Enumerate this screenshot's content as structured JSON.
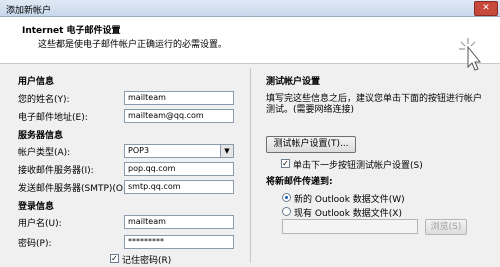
{
  "window": {
    "title": "添加新帐户",
    "close_glyph": "✕"
  },
  "header": {
    "title": "Internet 电子邮件设置",
    "description": "这些都是使电子邮件帐户正确运行的必需设置。",
    "icon": "wizard-cursor-icon"
  },
  "user_info": {
    "heading": "用户信息",
    "name_label": "您的姓名(Y):",
    "name_value": "mailteam",
    "email_label": "电子邮件地址(E):",
    "email_value": "mailteam@qq.com"
  },
  "server_info": {
    "heading": "服务器信息",
    "account_type_label": "帐户类型(A):",
    "account_type_value": "POP3",
    "incoming_label": "接收邮件服务器(I):",
    "incoming_value": "pop.qq.com",
    "outgoing_label": "发送邮件服务器(SMTP)(O):",
    "outgoing_value": "smtp.qq.com"
  },
  "login_info": {
    "heading": "登录信息",
    "username_label": "用户名(U):",
    "username_value": "mailteam",
    "password_label": "密码(P):",
    "password_value": "*********",
    "remember_label": "记住密码(R)",
    "remember_checked": true
  },
  "test_settings": {
    "heading": "测试帐户设置",
    "description_line1": "填写完这些信息之后，建议您单击下面的按钮进行帐户",
    "description_line2": "测试。(需要网络连接)",
    "test_button": "测试帐户设置(T)...",
    "auto_test_label": "单击下一步按钮测试帐户设置(S)",
    "auto_test_checked": true
  },
  "deliver": {
    "heading": "将新邮件传递到:",
    "option_new": "新的 Outlook 数据文件(W)",
    "option_existing": "现有 Outlook 数据文件(X)",
    "selected": "new",
    "path_value": "",
    "browse_button": "浏览(S)"
  }
}
